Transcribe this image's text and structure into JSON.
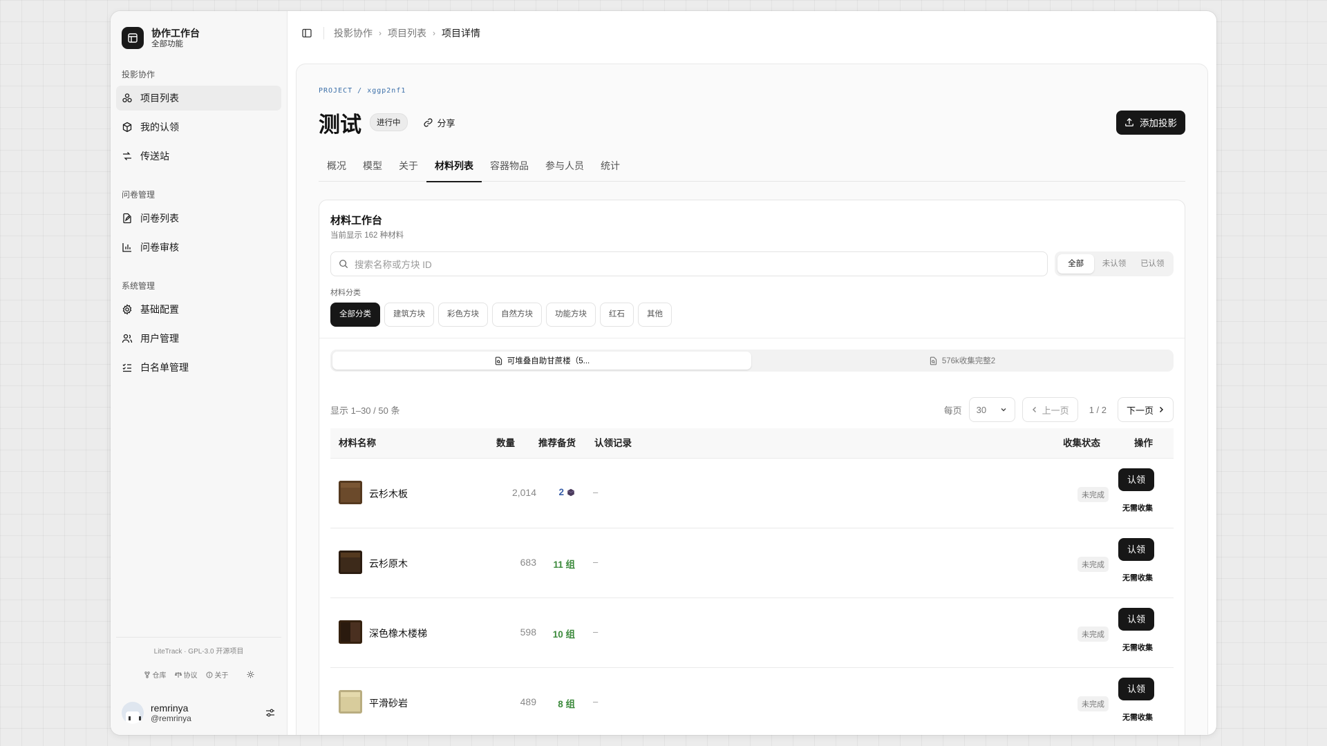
{
  "sidebar": {
    "brand_title": "协作工作台",
    "brand_sub": "全部功能",
    "sections": [
      {
        "heading": "投影协作",
        "items": [
          "项目列表",
          "我的认领",
          "传送站"
        ]
      },
      {
        "heading": "问卷管理",
        "items": [
          "问卷列表",
          "问卷审核"
        ]
      },
      {
        "heading": "系统管理",
        "items": [
          "基础配置",
          "用户管理",
          "白名单管理"
        ]
      }
    ],
    "license": "LiteTrack · GPL-3.0 开源项目",
    "links": [
      "仓库",
      "协议",
      "关于"
    ],
    "user_name": "remrinya",
    "user_handle": "@remrinya"
  },
  "breadcrumb": [
    "投影协作",
    "项目列表",
    "项目详情"
  ],
  "project": {
    "tag": "PROJECT / xggp2nf1",
    "title": "测试",
    "status": "进行中",
    "share_label": "分享",
    "add_label": "添加投影"
  },
  "tabs": [
    "概况",
    "模型",
    "关于",
    "材料列表",
    "容器物品",
    "参与人员",
    "统计"
  ],
  "active_tab": "材料列表",
  "workbench": {
    "title": "材料工作台",
    "subtitle": "当前显示 162 种材料",
    "search_placeholder": "搜索名称或方块 ID",
    "filters": [
      "全部",
      "未认领",
      "已认领"
    ],
    "category_label": "材料分类",
    "categories": [
      "全部分类",
      "建筑方块",
      "彩色方块",
      "自然方块",
      "功能方块",
      "红石",
      "其他"
    ],
    "groups": [
      "可堆叠自助甘蔗楼（5...",
      "576k收集完整2"
    ],
    "range_text": "显示 1–30 / 50 条",
    "per_page_label": "每页",
    "per_page_value": "30",
    "prev_label": "上一页",
    "page_info": "1 / 2",
    "next_label": "下一页"
  },
  "table": {
    "headers": [
      "材料名称",
      "数量",
      "推荐备货",
      "认领记录",
      "收集状态",
      "操作"
    ],
    "rows": [
      {
        "name": "云杉木板",
        "qty": "2,014",
        "rec": "2",
        "claim": "–",
        "status": "未完成",
        "action": "认领",
        "note": "无需收集",
        "color": "#6b4a2b"
      },
      {
        "name": "云杉原木",
        "qty": "683",
        "rec": "11 组",
        "claim": "–",
        "status": "未完成",
        "action": "认领",
        "note": "无需收集",
        "color": "#3d2a1a"
      },
      {
        "name": "深色橡木楼梯",
        "qty": "598",
        "rec": "10 组",
        "claim": "–",
        "status": "未完成",
        "action": "认领",
        "note": "无需收集",
        "color": "#4a3020"
      },
      {
        "name": "平滑砂岩",
        "qty": "489",
        "rec": "8 组",
        "claim": "–",
        "status": "未完成",
        "action": "认领",
        "note": "无需收集",
        "color": "#d8cc9c"
      }
    ]
  },
  "colors": {
    "accent": "#171717",
    "recommend": "#3c8a3c",
    "tag": "#3a6ea8"
  }
}
